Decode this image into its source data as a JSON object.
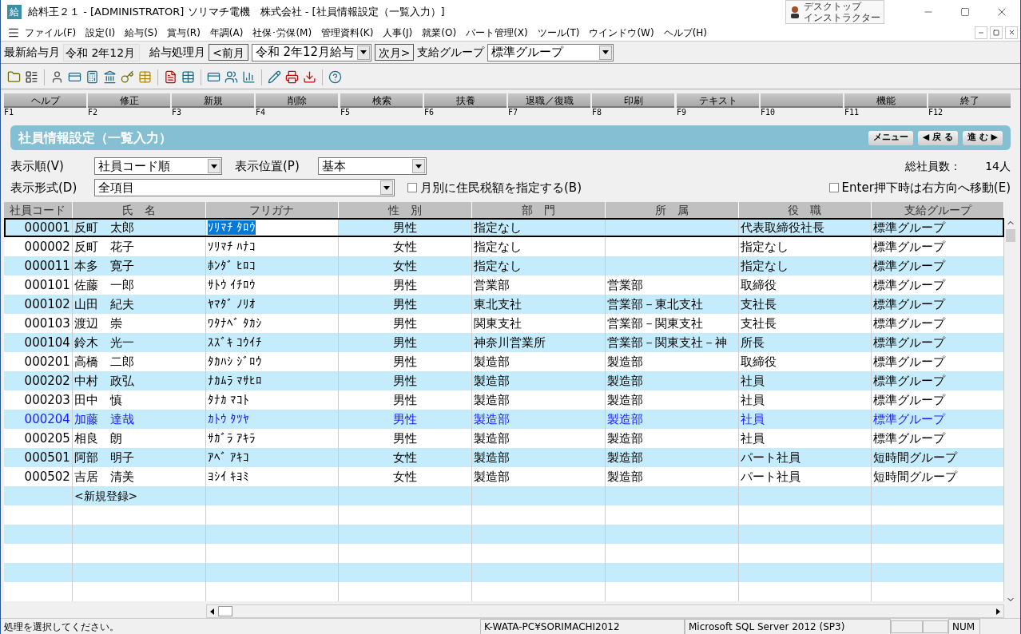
{
  "window": {
    "title": "給料王２１ - [ADMINISTRATOR] ソリマチ電機　株式会社 - [社員情報設定（一覧入力）]",
    "app_icon": "給",
    "assistant_label": [
      "デスクトップ",
      "インストラクター"
    ]
  },
  "menu": [
    "ファイル(F)",
    "設定(I)",
    "給与(S)",
    "賞与(R)",
    "年調(A)",
    "社保･労保(M)",
    "管理資料(K)",
    "人事(J)",
    "就業(O)",
    "パート管理(X)",
    "ツール(T)",
    "ウインドウ(W)",
    "ヘルプ(H)"
  ],
  "period_bar": {
    "latest_label": "最新給与月",
    "latest_value": "令和 2年12月",
    "process_label": "給与処理月",
    "prev_button": "<前月",
    "process_value": "令和 2年12月給与",
    "next_button": "次月>",
    "group_label": "支給グループ",
    "group_value": "標準グループ"
  },
  "function_keys": [
    {
      "label": "ヘルプ",
      "key": "F1"
    },
    {
      "label": "修正",
      "key": "F2"
    },
    {
      "label": "新規",
      "key": "F3"
    },
    {
      "label": "削除",
      "key": "F4"
    },
    {
      "label": "検索",
      "key": "F5"
    },
    {
      "label": "扶養",
      "key": "F6"
    },
    {
      "label": "退職／復職",
      "key": "F7"
    },
    {
      "label": "印刷",
      "key": "F8"
    },
    {
      "label": "テキスト",
      "key": "F9"
    },
    {
      "key": "F10"
    },
    {
      "label": "機能",
      "key": "F11"
    },
    {
      "label": "終了",
      "key": "F12"
    }
  ],
  "panel": {
    "title": "社員情報設定（一覧入力）",
    "buttons": [
      "メニュー",
      "◀ 戻 る",
      "進 む ▶"
    ]
  },
  "options": {
    "order_label": "表示順(V)",
    "order_value": "社員コード順",
    "position_label": "表示位置(P)",
    "position_value": "基本",
    "total_label": "総社員数：",
    "total_value": "14人",
    "format_label": "表示形式(D)",
    "format_value": "全項目",
    "monthly_tax": {
      "label": "月別に住民税額を指定する(B)",
      "checked": false
    },
    "enter_right": {
      "label": "Enter押下時は右方向へ移動(E)",
      "checked": false
    }
  },
  "table": {
    "columns": [
      "社員コード",
      "氏　名",
      "フリガナ",
      "性　別",
      "部　門",
      "所　属",
      "役　職",
      "支給グループ"
    ],
    "rows": [
      {
        "cells": [
          "000001",
          "反町　太郎",
          "ｿﾘﾏﾁ ﾀﾛｳ",
          "男性",
          "指定なし",
          "",
          "代表取締役社長",
          "標準グループ"
        ],
        "selected": true,
        "highlighted": false
      },
      {
        "cells": [
          "000002",
          "反町　花子",
          "ｿﾘﾏﾁ ﾊﾅｺ",
          "女性",
          "指定なし",
          "",
          "指定なし",
          "標準グループ"
        ],
        "selected": false,
        "highlighted": false
      },
      {
        "cells": [
          "000011",
          "本多　寛子",
          "ﾎﾝﾀﾞ ﾋﾛｺ",
          "女性",
          "指定なし",
          "",
          "指定なし",
          "標準グループ"
        ],
        "selected": false,
        "highlighted": false
      },
      {
        "cells": [
          "000101",
          "佐藤　一郎",
          "ｻﾄｳ ｲﾁﾛｳ",
          "男性",
          "営業部",
          "営業部",
          "取締役",
          "標準グループ"
        ],
        "selected": false,
        "highlighted": false
      },
      {
        "cells": [
          "000102",
          "山田　紀夫",
          "ﾔﾏﾀﾞ ﾉﾘｵ",
          "男性",
          "東北支社",
          "営業部－東北支社",
          "支社長",
          "標準グループ"
        ],
        "selected": false,
        "highlighted": false
      },
      {
        "cells": [
          "000103",
          "渡辺　崇",
          "ﾜﾀﾅﾍﾞ ﾀｶｼ",
          "男性",
          "関東支社",
          "営業部－関東支社",
          "支社長",
          "標準グループ"
        ],
        "selected": false,
        "highlighted": false
      },
      {
        "cells": [
          "000104",
          "鈴木　光一",
          "ｽｽﾞｷ ｺｳｲﾁ",
          "男性",
          "神奈川営業所",
          "営業部－関東支社－神",
          "所長",
          "標準グループ"
        ],
        "selected": false,
        "highlighted": false
      },
      {
        "cells": [
          "000201",
          "高橋　二郎",
          "ﾀｶﾊｼ ｼﾞﾛｳ",
          "男性",
          "製造部",
          "製造部",
          "取締役",
          "標準グループ"
        ],
        "selected": false,
        "highlighted": false
      },
      {
        "cells": [
          "000202",
          "中村　政弘",
          "ﾅｶﾑﾗ ﾏｻﾋﾛ",
          "男性",
          "製造部",
          "製造部",
          "社員",
          "標準グループ"
        ],
        "selected": false,
        "highlighted": false
      },
      {
        "cells": [
          "000203",
          "田中　慎",
          "ﾀﾅｶ ﾏｺﾄ",
          "男性",
          "製造部",
          "製造部",
          "社員",
          "標準グループ"
        ],
        "selected": false,
        "highlighted": false
      },
      {
        "cells": [
          "000204",
          "加藤　達哉",
          "ｶﾄｳ ﾀﾂﾔ",
          "男性",
          "製造部",
          "製造部",
          "社員",
          "標準グループ"
        ],
        "selected": false,
        "highlighted": true
      },
      {
        "cells": [
          "000205",
          "相良　朗",
          "ｻｶﾞﾗ ｱｷﾗ",
          "男性",
          "製造部",
          "製造部",
          "社員",
          "標準グループ"
        ],
        "selected": false,
        "highlighted": false
      },
      {
        "cells": [
          "000501",
          "阿部　明子",
          "ｱﾍﾞ ｱｷｺ",
          "女性",
          "製造部",
          "製造部",
          "パート社員",
          "短時間グループ"
        ],
        "selected": false,
        "highlighted": false
      },
      {
        "cells": [
          "000502",
          "吉居　清美",
          "ﾖｼｲ ｷﾖﾐ",
          "女性",
          "製造部",
          "製造部",
          "パート社員",
          "短時間グループ"
        ],
        "selected": false,
        "highlighted": false
      }
    ],
    "new_entry": "<新規登録>"
  },
  "status_bar": {
    "message": "処理を選択してください。",
    "server": "K-WATA-PC¥SORIMACHI2012",
    "database": "Microsoft SQL Server 2012 (SP3)",
    "num": "NUM"
  }
}
